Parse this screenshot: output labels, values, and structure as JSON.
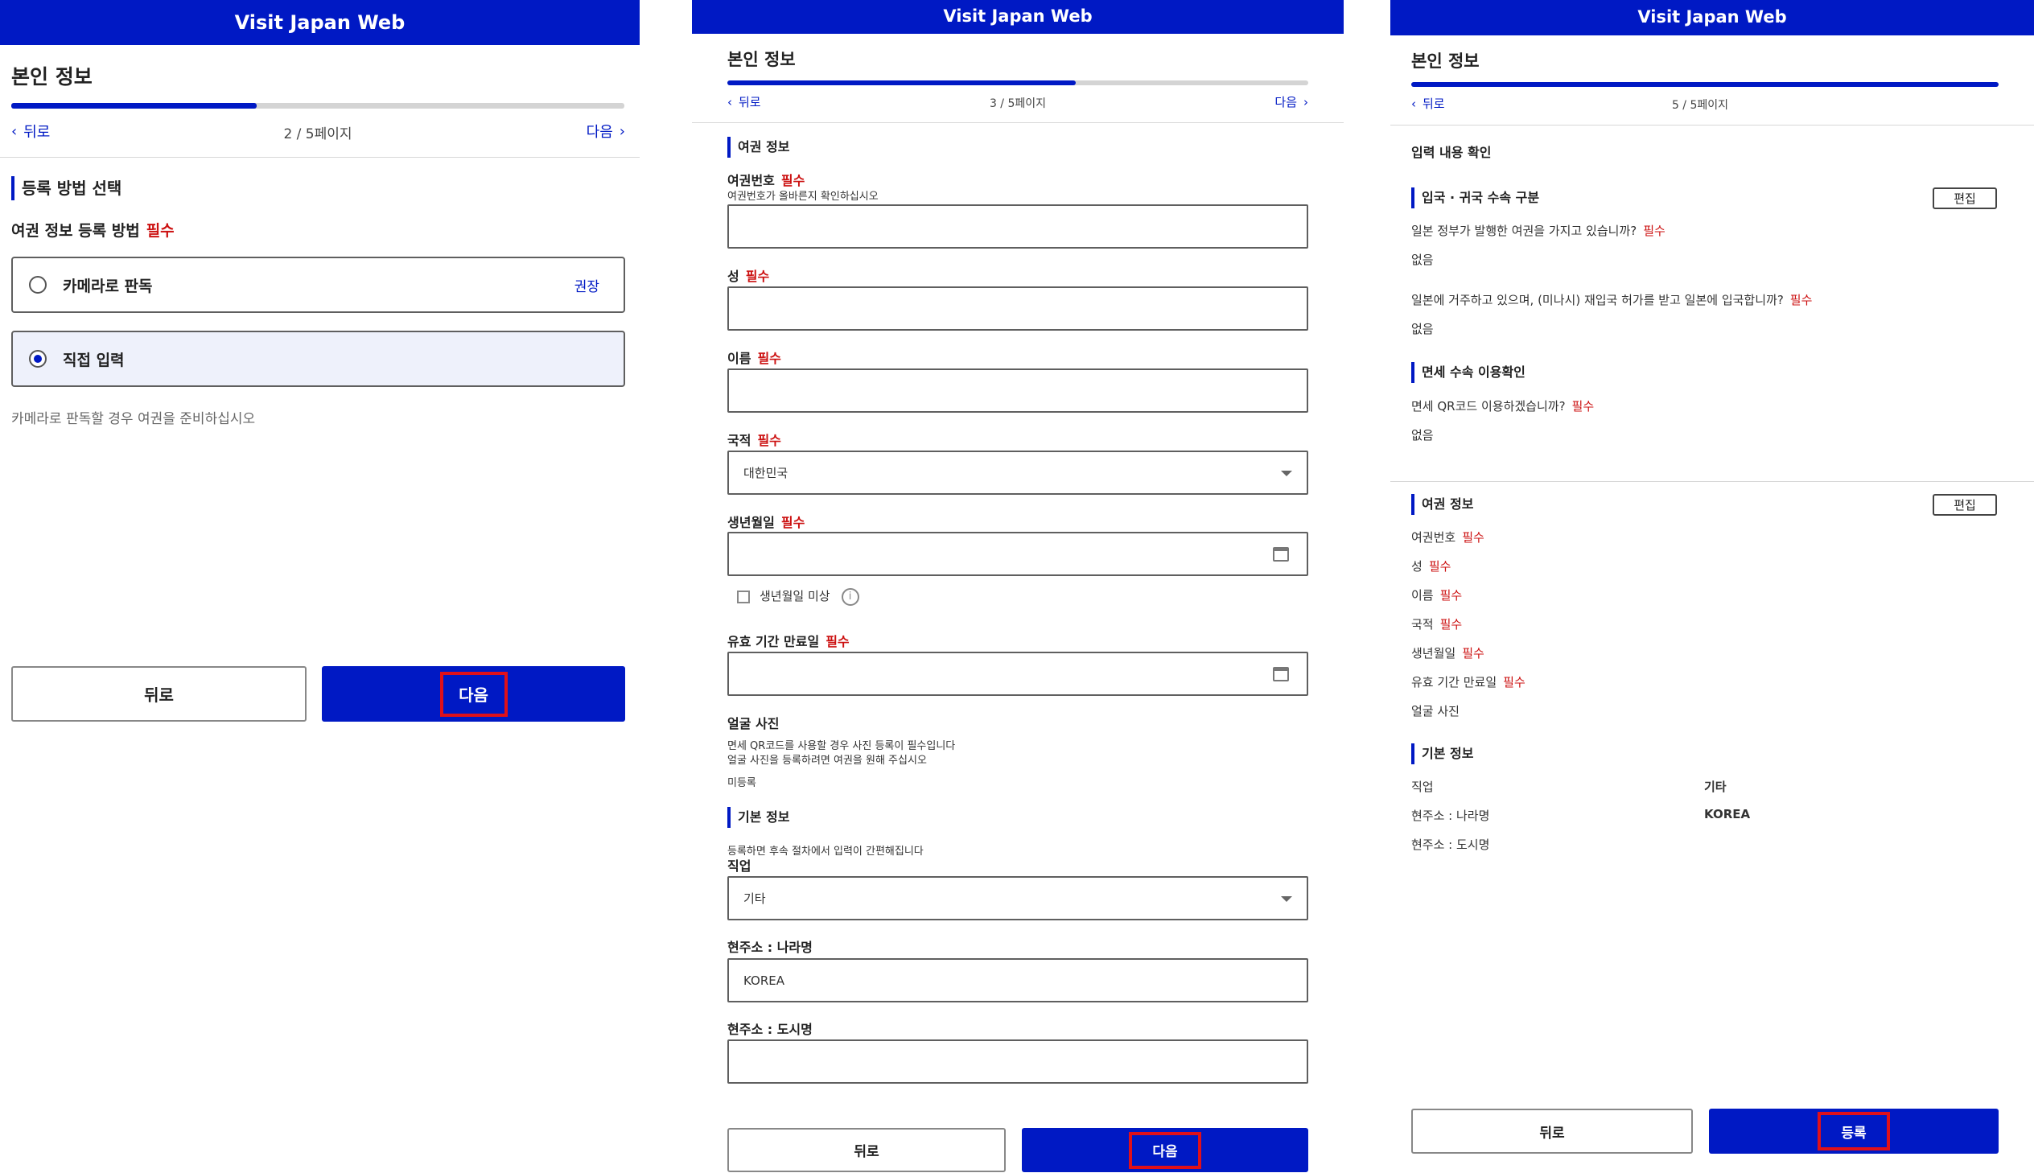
{
  "brand_color": "#0019c4",
  "highlight_color": "#e0101a",
  "icons": {
    "back": "chevron-left-icon",
    "next": "chevron-right-icon",
    "dropdown": "caret-down-icon",
    "date": "calendar-icon",
    "help": "info-icon"
  },
  "p1": {
    "header": "Visit Japan Web",
    "title": "본인 정보",
    "progress": 0.4,
    "back": "뒤로",
    "page": "2 / 5페이지",
    "next": "다음",
    "section": "등록 방법 선택",
    "method_label": "여권 정보 등록 방법",
    "required": "필수",
    "option_camera": "카메라로 판독",
    "option_camera_badge": "권장",
    "option_manual": "직접 입력",
    "selected": "manual",
    "hint": "카메라로 판독할 경우 여권을 준비하십시오",
    "btn_back": "뒤로",
    "btn_next": "다음"
  },
  "p2": {
    "header": "Visit Japan Web",
    "title": "본인 정보",
    "progress": 0.6,
    "back": "뒤로",
    "page": "3 / 5페이지",
    "next": "다음",
    "section_passport": "여권 정보",
    "required": "필수",
    "passport_no": "여권번호",
    "passport_hint": "여권번호가 올바른지 확인하십시오",
    "surname": "성",
    "given_name": "이름",
    "nationality": "국적",
    "nationality_value": "대한민국",
    "dob": "생년월일",
    "dob_unknown": "생년월일 미상",
    "expiry": "유효 기간 만료일",
    "photo": "얼굴 사진",
    "photo_hint1": "면세 QR코드를 사용할 경우 사진 등록이 필수입니다",
    "photo_hint2": "얼굴 사진을 등록하려면 여권을 원해 주십시오",
    "photo_status": "미등록",
    "section_basic": "기본 정보",
    "basic_hint": "등록하면 후속 절차에서 입력이 간편해집니다",
    "occupation": "직업",
    "occupation_value": "기타",
    "country": "현주소 : 나라명",
    "country_value": "KOREA",
    "city": "현주소 : 도시명",
    "btn_back": "뒤로",
    "btn_next": "다음"
  },
  "p3": {
    "header": "Visit Japan Web",
    "title": "본인 정보",
    "progress": 1.0,
    "back": "뒤로",
    "page": "5 / 5페이지",
    "confirm": "입력 내용 확인",
    "required": "필수",
    "edit": "편집",
    "section_entry": "입국 · 귀국 수속 구분",
    "q_jp_passport": "일본 정부가 발행한 여권을 가지고 있습니까?",
    "a_jp_passport": "없음",
    "q_reentry": "일본에 거주하고 있으며, (미나시) 재입국 허가를 받고 일본에 입국합니까?",
    "a_reentry": "없음",
    "section_taxfree": "면세 수속 이용확인",
    "q_taxfree": "면세 QR코드 이용하겠습니까?",
    "a_taxfree": "없음",
    "section_passport": "여권 정보",
    "f_passport": "여권번호",
    "f_surname": "성",
    "f_given": "이름",
    "f_nationality": "국적",
    "f_dob": "생년월일",
    "f_expiry": "유효 기간 만료일",
    "f_photo": "얼굴 사진",
    "section_basic": "기본 정보",
    "f_occupation": "직업",
    "v_occupation": "기타",
    "f_country": "현주소 : 나라명",
    "v_country": "KOREA",
    "f_city": "현주소 : 도시명",
    "btn_back": "뒤로",
    "btn_submit": "등록"
  }
}
